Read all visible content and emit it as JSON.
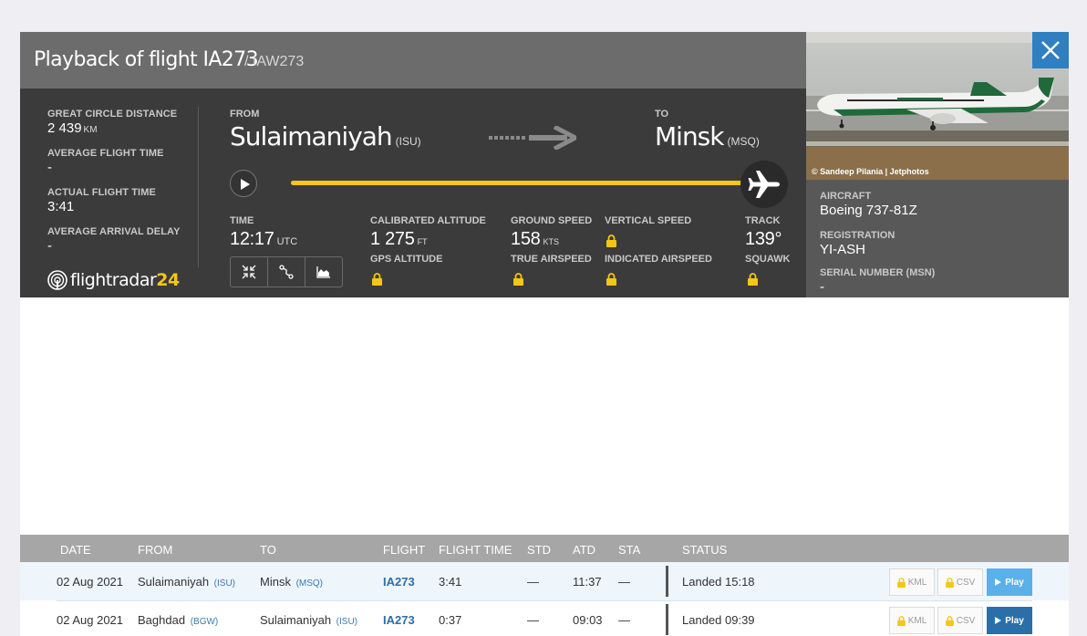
{
  "header": {
    "title": "Playback of flight IA273",
    "subtitle": "/ IAW273"
  },
  "stats": [
    {
      "label": "GREAT CIRCLE DISTANCE",
      "value": "2 439",
      "unit": "KM"
    },
    {
      "label": "AVERAGE FLIGHT TIME",
      "value": "-",
      "unit": ""
    },
    {
      "label": "ACTUAL FLIGHT TIME",
      "value": "3:41",
      "unit": ""
    },
    {
      "label": "AVERAGE ARRIVAL DELAY",
      "value": "-",
      "unit": ""
    }
  ],
  "logo": {
    "text": "flightradar",
    "num": "24"
  },
  "route": {
    "from_label": "FROM",
    "from_city": "Sulaimaniyah",
    "from_code": "(ISU)",
    "to_label": "TO",
    "to_city": "Minsk",
    "to_code": "(MSQ)"
  },
  "playback": {
    "progress": 1.0
  },
  "telemetry": {
    "time_label": "TIME",
    "time_value": "12:17",
    "time_unit": "UTC",
    "cal_alt_label": "CALIBRATED ALTITUDE",
    "cal_alt_value": "1 275",
    "cal_alt_unit": "FT",
    "gps_alt_label": "GPS ALTITUDE",
    "ground_speed_label": "GROUND SPEED",
    "ground_speed_value": "158",
    "ground_speed_unit": "KTS",
    "true_airspeed_label": "TRUE AIRSPEED",
    "vertical_speed_label": "VERTICAL SPEED",
    "indicated_airspeed_label": "INDICATED AIRSPEED",
    "track_label": "TRACK",
    "track_value": "139°",
    "squawk_label": "SQUAWK"
  },
  "aircraft": {
    "photo_credit": "© Sandeep Pilania | Jetphotos",
    "aircraft_label": "AIRCRAFT",
    "aircraft_value": "Boeing 737-81Z",
    "registration_label": "REGISTRATION",
    "registration_value": "YI-ASH",
    "serial_label": "SERIAL NUMBER (MSN)",
    "serial_value": "-"
  },
  "table": {
    "headers": [
      "DATE",
      "FROM",
      "TO",
      "FLIGHT",
      "FLIGHT TIME",
      "STD",
      "ATD",
      "STA",
      "STATUS"
    ],
    "rows": [
      {
        "date": "02 Aug 2021",
        "from": "Sulaimaniyah",
        "from_code": "(ISU)",
        "to": "Minsk",
        "to_code": "(MSQ)",
        "flight": "IA273",
        "flight_time": "3:41",
        "std": "—",
        "atd": "11:37",
        "sta": "—",
        "status": "Landed 15:18",
        "kml": "KML",
        "csv": "CSV",
        "play": "Play"
      },
      {
        "date": "02 Aug 2021",
        "from": "Baghdad",
        "from_code": "(BGW)",
        "to": "Sulaimaniyah",
        "to_code": "(ISU)",
        "flight": "IA273",
        "flight_time": "0:37",
        "std": "—",
        "atd": "09:03",
        "sta": "—",
        "status": "Landed 09:39",
        "kml": "KML",
        "csv": "CSV",
        "play": "Play"
      }
    ]
  },
  "colors": {
    "accent_yellow": "#f5c518",
    "close_blue": "#2f7fc1",
    "play_light": "#5ab0e8",
    "play_dark": "#2a6fa8"
  }
}
